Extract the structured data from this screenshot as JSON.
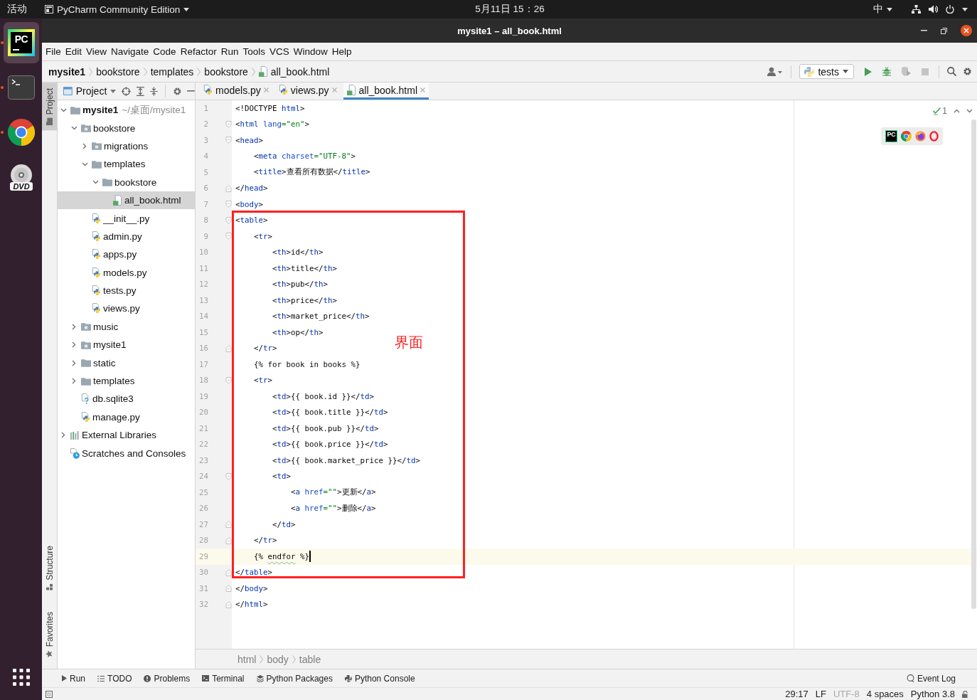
{
  "top_bar": {
    "activities": "活动",
    "app_menu": "PyCharm Community Edition",
    "clock": "5月11日 15：26",
    "input_method": "中"
  },
  "dock": [
    {
      "kind": "pycharm",
      "logo_text": "PC",
      "running": true,
      "selected": true
    },
    {
      "kind": "terminal",
      "running": true,
      "selected": false
    },
    {
      "kind": "chrome",
      "running": true,
      "selected": false
    },
    {
      "kind": "dvd",
      "logo_text": "DVD",
      "running": false,
      "selected": false
    }
  ],
  "window": {
    "title": "mysite1 – all_book.html"
  },
  "menu": [
    "File",
    "Edit",
    "View",
    "Navigate",
    "Code",
    "Refactor",
    "Run",
    "Tools",
    "VCS",
    "Window",
    "Help"
  ],
  "navigation": {
    "breadcrumb": [
      {
        "label": "mysite1",
        "kind": "project"
      },
      {
        "label": "bookstore",
        "kind": "folder"
      },
      {
        "label": "templates",
        "kind": "folder"
      },
      {
        "label": "bookstore",
        "kind": "folder"
      },
      {
        "label": "all_book.html",
        "kind": "html"
      }
    ],
    "run_config": "tests",
    "actions": [
      {
        "kind": "run",
        "disabled": false
      },
      {
        "kind": "debug",
        "disabled": false
      },
      {
        "kind": "coverage",
        "disabled": true
      },
      {
        "kind": "stop",
        "disabled": true
      }
    ]
  },
  "side_stripe": {
    "top": [
      {
        "label": "Project",
        "kind": "project",
        "selected": true
      }
    ],
    "bottom": [
      {
        "label": "Structure",
        "kind": "structure",
        "selected": false
      },
      {
        "label": "Favorites",
        "kind": "favorites",
        "selected": false
      }
    ]
  },
  "project_panel": {
    "title": "Project",
    "tree": [
      {
        "label": "mysite1",
        "kind": "project",
        "note": "~/桌面/mysite1",
        "expanded": true,
        "selected": false,
        "children": [
          {
            "label": "bookstore",
            "kind": "package",
            "expanded": true,
            "selected": false,
            "children": [
              {
                "label": "migrations",
                "kind": "package",
                "expanded": false,
                "selected": false
              },
              {
                "label": "templates",
                "kind": "folder",
                "expanded": true,
                "selected": false,
                "children": [
                  {
                    "label": "bookstore",
                    "kind": "folder",
                    "expanded": true,
                    "selected": false,
                    "children": [
                      {
                        "label": "all_book.html",
                        "kind": "html",
                        "selected": true
                      }
                    ]
                  }
                ]
              },
              {
                "label": "__init__.py",
                "kind": "python",
                "selected": false
              },
              {
                "label": "admin.py",
                "kind": "python",
                "selected": false
              },
              {
                "label": "apps.py",
                "kind": "python",
                "selected": false
              },
              {
                "label": "models.py",
                "kind": "python",
                "selected": false
              },
              {
                "label": "tests.py",
                "kind": "python",
                "selected": false
              },
              {
                "label": "views.py",
                "kind": "python",
                "selected": false
              }
            ]
          },
          {
            "label": "music",
            "kind": "package",
            "expanded": false,
            "selected": false
          },
          {
            "label": "mysite1",
            "kind": "package",
            "expanded": false,
            "selected": false
          },
          {
            "label": "static",
            "kind": "folder",
            "expanded": false,
            "selected": false
          },
          {
            "label": "templates",
            "kind": "folder",
            "expanded": false,
            "selected": false
          },
          {
            "label": "db.sqlite3",
            "kind": "unknown",
            "selected": false
          },
          {
            "label": "manage.py",
            "kind": "python",
            "selected": false
          }
        ]
      },
      {
        "label": "External Libraries",
        "kind": "libraries",
        "expanded": false,
        "selected": false
      },
      {
        "label": "Scratches and Consoles",
        "kind": "scratches",
        "selected": false
      }
    ]
  },
  "editor": {
    "tabs": [
      {
        "label": "models.py",
        "kind": "python",
        "selected": false
      },
      {
        "label": "views.py",
        "kind": "python",
        "selected": false
      },
      {
        "label": "all_book.html",
        "kind": "html",
        "selected": true
      }
    ],
    "lines": [
      {
        "number": "1",
        "current": false,
        "fold_start": false,
        "fold_end": false,
        "tokens": [
          {
            "kind": "plain",
            "text": "<!DOCTYPE "
          },
          {
            "kind": "tag",
            "text": "html"
          },
          {
            "kind": "plain",
            "text": ">"
          }
        ]
      },
      {
        "number": "2",
        "current": false,
        "fold_start": true,
        "fold_end": false,
        "tokens": [
          {
            "kind": "plain",
            "text": "<"
          },
          {
            "kind": "tag",
            "text": "html"
          },
          {
            "kind": "attr",
            "text": " lang"
          },
          {
            "kind": "value",
            "text": "=\"en\""
          },
          {
            "kind": "plain",
            "text": ">"
          }
        ]
      },
      {
        "number": "3",
        "current": false,
        "fold_start": true,
        "fold_end": false,
        "tokens": [
          {
            "kind": "plain",
            "text": "<"
          },
          {
            "kind": "tag",
            "text": "head"
          },
          {
            "kind": "plain",
            "text": ">"
          }
        ],
        "children": [
          {
            "number": "4",
            "current": false,
            "fold_start": false,
            "fold_end": false,
            "tokens": [
              {
                "kind": "plain",
                "text": "<"
              },
              {
                "kind": "tag",
                "text": "meta"
              },
              {
                "kind": "attr",
                "text": " charset"
              },
              {
                "kind": "value",
                "text": "=\"UTF-8\""
              },
              {
                "kind": "plain",
                "text": ">"
              }
            ]
          },
          {
            "number": "5",
            "current": false,
            "fold_start": false,
            "fold_end": false,
            "tokens": [
              {
                "kind": "plain",
                "text": "<"
              },
              {
                "kind": "tag",
                "text": "title"
              },
              {
                "kind": "plain",
                "text": ">查看所有数据</"
              },
              {
                "kind": "tag",
                "text": "title"
              },
              {
                "kind": "plain",
                "text": ">"
              }
            ]
          }
        ]
      },
      {
        "number": "6",
        "current": false,
        "fold_start": false,
        "fold_end": true,
        "tokens": [
          {
            "kind": "plain",
            "text": "</"
          },
          {
            "kind": "tag",
            "text": "head"
          },
          {
            "kind": "plain",
            "text": ">"
          }
        ]
      },
      {
        "number": "7",
        "current": false,
        "fold_start": true,
        "fold_end": false,
        "tokens": [
          {
            "kind": "plain",
            "text": "<"
          },
          {
            "kind": "tag",
            "text": "body"
          },
          {
            "kind": "plain",
            "text": ">"
          }
        ]
      },
      {
        "number": "8",
        "current": false,
        "fold_start": true,
        "fold_end": false,
        "tokens": [
          {
            "kind": "plain",
            "text": "<"
          },
          {
            "kind": "tag",
            "text": "table"
          },
          {
            "kind": "plain",
            "text": ">"
          }
        ],
        "children": [
          {
            "number": "9",
            "current": false,
            "fold_start": true,
            "fold_end": false,
            "tokens": [
              {
                "kind": "plain",
                "text": "<"
              },
              {
                "kind": "tag",
                "text": "tr"
              },
              {
                "kind": "plain",
                "text": ">"
              }
            ],
            "children": [
              {
                "number": "10",
                "current": false,
                "fold_start": false,
                "fold_end": false,
                "tokens": [
                  {
                    "kind": "plain",
                    "text": "<"
                  },
                  {
                    "kind": "tag",
                    "text": "th"
                  },
                  {
                    "kind": "plain",
                    "text": ">id</"
                  },
                  {
                    "kind": "tag",
                    "text": "th"
                  },
                  {
                    "kind": "plain",
                    "text": ">"
                  }
                ]
              },
              {
                "number": "11",
                "current": false,
                "fold_start": false,
                "fold_end": false,
                "tokens": [
                  {
                    "kind": "plain",
                    "text": "<"
                  },
                  {
                    "kind": "tag",
                    "text": "th"
                  },
                  {
                    "kind": "plain",
                    "text": ">title</"
                  },
                  {
                    "kind": "tag",
                    "text": "th"
                  },
                  {
                    "kind": "plain",
                    "text": ">"
                  }
                ]
              },
              {
                "number": "12",
                "current": false,
                "fold_start": false,
                "fold_end": false,
                "tokens": [
                  {
                    "kind": "plain",
                    "text": "<"
                  },
                  {
                    "kind": "tag",
                    "text": "th"
                  },
                  {
                    "kind": "plain",
                    "text": ">pub</"
                  },
                  {
                    "kind": "tag",
                    "text": "th"
                  },
                  {
                    "kind": "plain",
                    "text": ">"
                  }
                ]
              },
              {
                "number": "13",
                "current": false,
                "fold_start": false,
                "fold_end": false,
                "tokens": [
                  {
                    "kind": "plain",
                    "text": "<"
                  },
                  {
                    "kind": "tag",
                    "text": "th"
                  },
                  {
                    "kind": "plain",
                    "text": ">price</"
                  },
                  {
                    "kind": "tag",
                    "text": "th"
                  },
                  {
                    "kind": "plain",
                    "text": ">"
                  }
                ]
              },
              {
                "number": "14",
                "current": false,
                "fold_start": false,
                "fold_end": false,
                "tokens": [
                  {
                    "kind": "plain",
                    "text": "<"
                  },
                  {
                    "kind": "tag",
                    "text": "th"
                  },
                  {
                    "kind": "plain",
                    "text": ">market_price</"
                  },
                  {
                    "kind": "tag",
                    "text": "th"
                  },
                  {
                    "kind": "plain",
                    "text": ">"
                  }
                ]
              },
              {
                "number": "15",
                "current": false,
                "fold_start": false,
                "fold_end": false,
                "tokens": [
                  {
                    "kind": "plain",
                    "text": "<"
                  },
                  {
                    "kind": "tag",
                    "text": "th"
                  },
                  {
                    "kind": "plain",
                    "text": ">op</"
                  },
                  {
                    "kind": "tag",
                    "text": "th"
                  },
                  {
                    "kind": "plain",
                    "text": ">"
                  }
                ]
              }
            ]
          },
          {
            "number": "16",
            "current": false,
            "fold_start": false,
            "fold_end": true,
            "tokens": [
              {
                "kind": "plain",
                "text": "</"
              },
              {
                "kind": "tag",
                "text": "tr"
              },
              {
                "kind": "plain",
                "text": ">"
              }
            ]
          },
          {
            "number": "17",
            "current": false,
            "fold_start": false,
            "fold_end": false,
            "tokens": [
              {
                "kind": "plain",
                "text": "{% for book in books %}"
              }
            ]
          },
          {
            "number": "18",
            "current": false,
            "fold_start": true,
            "fold_end": false,
            "tokens": [
              {
                "kind": "plain",
                "text": "<"
              },
              {
                "kind": "tag",
                "text": "tr"
              },
              {
                "kind": "plain",
                "text": ">"
              }
            ],
            "children": [
              {
                "number": "19",
                "current": false,
                "fold_start": false,
                "fold_end": false,
                "tokens": [
                  {
                    "kind": "plain",
                    "text": "<"
                  },
                  {
                    "kind": "tag",
                    "text": "td"
                  },
                  {
                    "kind": "plain",
                    "text": ">{{ book.id }}</"
                  },
                  {
                    "kind": "tag",
                    "text": "td"
                  },
                  {
                    "kind": "plain",
                    "text": ">"
                  }
                ]
              },
              {
                "number": "20",
                "current": false,
                "fold_start": false,
                "fold_end": false,
                "tokens": [
                  {
                    "kind": "plain",
                    "text": "<"
                  },
                  {
                    "kind": "tag",
                    "text": "td"
                  },
                  {
                    "kind": "plain",
                    "text": ">{{ book.title }}</"
                  },
                  {
                    "kind": "tag",
                    "text": "td"
                  },
                  {
                    "kind": "plain",
                    "text": ">"
                  }
                ]
              },
              {
                "number": "21",
                "current": false,
                "fold_start": false,
                "fold_end": false,
                "tokens": [
                  {
                    "kind": "plain",
                    "text": "<"
                  },
                  {
                    "kind": "tag",
                    "text": "td"
                  },
                  {
                    "kind": "plain",
                    "text": ">{{ book.pub }}</"
                  },
                  {
                    "kind": "tag",
                    "text": "td"
                  },
                  {
                    "kind": "plain",
                    "text": ">"
                  }
                ]
              },
              {
                "number": "22",
                "current": false,
                "fold_start": false,
                "fold_end": false,
                "tokens": [
                  {
                    "kind": "plain",
                    "text": "<"
                  },
                  {
                    "kind": "tag",
                    "text": "td"
                  },
                  {
                    "kind": "plain",
                    "text": ">{{ book.price }}</"
                  },
                  {
                    "kind": "tag",
                    "text": "td"
                  },
                  {
                    "kind": "plain",
                    "text": ">"
                  }
                ]
              },
              {
                "number": "23",
                "current": false,
                "fold_start": false,
                "fold_end": false,
                "tokens": [
                  {
                    "kind": "plain",
                    "text": "<"
                  },
                  {
                    "kind": "tag",
                    "text": "td"
                  },
                  {
                    "kind": "plain",
                    "text": ">{{ book.market_price }}</"
                  },
                  {
                    "kind": "tag",
                    "text": "td"
                  },
                  {
                    "kind": "plain",
                    "text": ">"
                  }
                ]
              },
              {
                "number": "24",
                "current": false,
                "fold_start": true,
                "fold_end": false,
                "tokens": [
                  {
                    "kind": "plain",
                    "text": "<"
                  },
                  {
                    "kind": "tag",
                    "text": "td"
                  },
                  {
                    "kind": "plain",
                    "text": ">"
                  }
                ],
                "children": [
                  {
                    "number": "25",
                    "current": false,
                    "fold_start": false,
                    "fold_end": false,
                    "tokens": [
                      {
                        "kind": "plain",
                        "text": "<"
                      },
                      {
                        "kind": "tag",
                        "text": "a"
                      },
                      {
                        "kind": "attr",
                        "text": " href"
                      },
                      {
                        "kind": "value",
                        "text": "=\"\""
                      },
                      {
                        "kind": "plain",
                        "text": ">更新</"
                      },
                      {
                        "kind": "tag",
                        "text": "a"
                      },
                      {
                        "kind": "plain",
                        "text": ">"
                      }
                    ]
                  },
                  {
                    "number": "26",
                    "current": false,
                    "fold_start": false,
                    "fold_end": false,
                    "tokens": [
                      {
                        "kind": "plain",
                        "text": "<"
                      },
                      {
                        "kind": "tag",
                        "text": "a"
                      },
                      {
                        "kind": "attr",
                        "text": " href"
                      },
                      {
                        "kind": "value",
                        "text": "=\"\""
                      },
                      {
                        "kind": "plain",
                        "text": ">删除</"
                      },
                      {
                        "kind": "tag",
                        "text": "a"
                      },
                      {
                        "kind": "plain",
                        "text": ">"
                      }
                    ]
                  }
                ]
              },
              {
                "number": "27",
                "current": false,
                "fold_start": false,
                "fold_end": true,
                "tokens": [
                  {
                    "kind": "plain",
                    "text": "</"
                  },
                  {
                    "kind": "tag",
                    "text": "td"
                  },
                  {
                    "kind": "plain",
                    "text": ">"
                  }
                ]
              }
            ]
          },
          {
            "number": "28",
            "current": false,
            "fold_start": false,
            "fold_end": true,
            "tokens": [
              {
                "kind": "plain",
                "text": "</"
              },
              {
                "kind": "tag",
                "text": "tr"
              },
              {
                "kind": "plain",
                "text": ">"
              }
            ]
          },
          {
            "number": "29",
            "current": true,
            "fold_start": false,
            "fold_end": false,
            "tokens": [
              {
                "kind": "plain",
                "text": "{% "
              },
              {
                "kind": "flagged",
                "text": "endfor"
              },
              {
                "kind": "plain",
                "text": " %}"
              }
            ]
          }
        ]
      },
      {
        "number": "30",
        "current": false,
        "fold_start": false,
        "fold_end": true,
        "tokens": [
          {
            "kind": "plain",
            "text": "</"
          },
          {
            "kind": "tag",
            "text": "table"
          },
          {
            "kind": "plain",
            "text": ">"
          }
        ]
      },
      {
        "number": "31",
        "current": false,
        "fold_start": false,
        "fold_end": true,
        "tokens": [
          {
            "kind": "plain",
            "text": "</"
          },
          {
            "kind": "tag",
            "text": "body"
          },
          {
            "kind": "plain",
            "text": ">"
          }
        ]
      },
      {
        "number": "32",
        "current": false,
        "fold_start": false,
        "fold_end": true,
        "tokens": [
          {
            "kind": "plain",
            "text": "</"
          },
          {
            "kind": "tag",
            "text": "html"
          },
          {
            "kind": "plain",
            "text": ">"
          }
        ]
      }
    ],
    "inspection_count": "1",
    "browsers": [
      {
        "kind": "pycharm",
        "logo_text": "PC"
      },
      {
        "kind": "chrome"
      },
      {
        "kind": "firefox"
      },
      {
        "kind": "opera"
      }
    ],
    "annotation": {
      "label": "界面"
    },
    "path": [
      "html",
      "body",
      "table"
    ]
  },
  "tool_windows": [
    {
      "label": "Run",
      "kind": "run"
    },
    {
      "label": "TODO",
      "kind": "todo"
    },
    {
      "label": "Problems",
      "kind": "problems"
    },
    {
      "label": "Terminal",
      "kind": "terminal"
    },
    {
      "label": "Python Packages",
      "kind": "packages"
    },
    {
      "label": "Python Console",
      "kind": "console"
    }
  ],
  "event_log": "Event Log",
  "status_bar": [
    {
      "text": "29:17",
      "disabled": false
    },
    {
      "text": "LF",
      "disabled": false
    },
    {
      "text": "UTF-8",
      "disabled": true
    },
    {
      "text": "4 spaces",
      "disabled": false
    },
    {
      "text": "Python 3.8",
      "disabled": false
    }
  ]
}
